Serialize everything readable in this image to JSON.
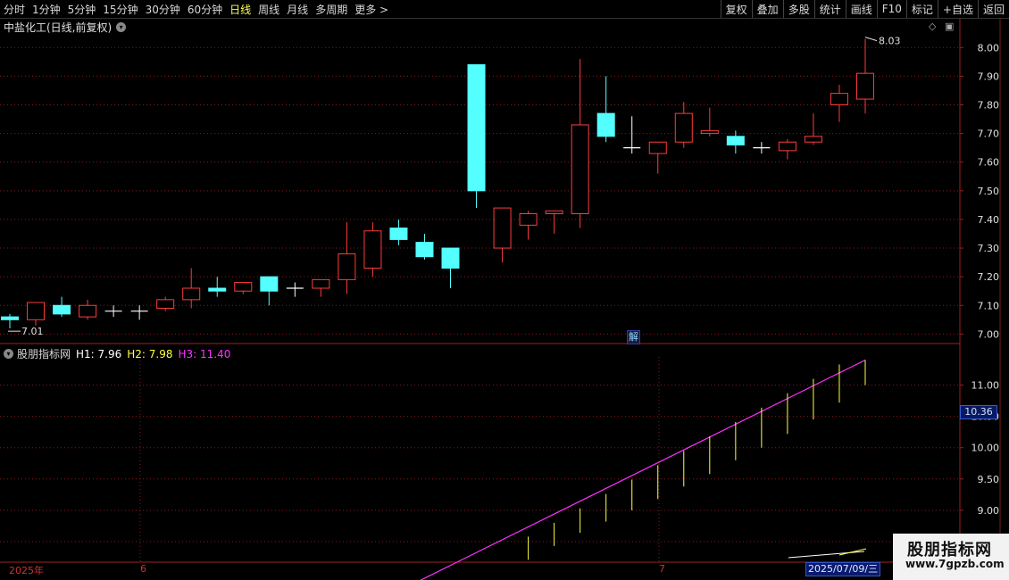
{
  "toolbar": {
    "periods": [
      "分时",
      "1分钟",
      "5分钟",
      "15分钟",
      "30分钟",
      "60分钟",
      "日线",
      "周线",
      "月线",
      "多周期",
      "更多 >"
    ],
    "active": "日线",
    "right_buttons": [
      "复权",
      "叠加",
      "多股",
      "统计",
      "画线",
      "F10",
      "标记",
      "+自选",
      "返回"
    ]
  },
  "main_chart": {
    "title": "中盐化工(日线,前复权)",
    "high_label": "8.03",
    "low_label": "7.01",
    "jie_label": "解"
  },
  "indicator": {
    "name": "股朋指标网",
    "h1": "H1: 7.96",
    "h2": "H2: 7.98",
    "h3": "H3: 11.40",
    "current_value": "10.36"
  },
  "dates": {
    "year": "2025年",
    "month6": "6",
    "month7": "7",
    "selected": "2025/07/09/三"
  },
  "watermark": {
    "line1": "股朋指标网",
    "line2": "www.7gpzb.com"
  },
  "colors": {
    "up": "#ff3c3c",
    "down": "#54ffff",
    "h3": "#ff33ff",
    "h1": "#ffffff",
    "h2": "#ffff44",
    "grid": "#8a1a1a"
  },
  "chart_data": {
    "type": "candlestick",
    "y_ticks": [
      "8.00",
      "7.90",
      "7.80",
      "7.70",
      "7.60",
      "7.50",
      "7.40",
      "7.30",
      "7.20",
      "7.10",
      "7.00"
    ],
    "y_range": [
      6.97,
      8.06
    ],
    "candles": [
      {
        "o": 7.06,
        "h": 7.07,
        "l": 7.02,
        "c": 7.05
      },
      {
        "o": 7.05,
        "h": 7.11,
        "l": 7.03,
        "c": 7.11
      },
      {
        "o": 7.1,
        "h": 7.13,
        "l": 7.06,
        "c": 7.07
      },
      {
        "o": 7.06,
        "h": 7.12,
        "l": 7.05,
        "c": 7.1
      },
      {
        "o": 7.08,
        "h": 7.1,
        "l": 7.06,
        "c": 7.08
      },
      {
        "o": 7.08,
        "h": 7.1,
        "l": 7.05,
        "c": 7.08
      },
      {
        "o": 7.09,
        "h": 7.13,
        "l": 7.08,
        "c": 7.12
      },
      {
        "o": 7.12,
        "h": 7.23,
        "l": 7.09,
        "c": 7.16
      },
      {
        "o": 7.16,
        "h": 7.2,
        "l": 7.13,
        "c": 7.15
      },
      {
        "o": 7.15,
        "h": 7.18,
        "l": 7.14,
        "c": 7.18
      },
      {
        "o": 7.2,
        "h": 7.2,
        "l": 7.1,
        "c": 7.15
      },
      {
        "o": 7.16,
        "h": 7.18,
        "l": 7.13,
        "c": 7.16
      },
      {
        "o": 7.16,
        "h": 7.19,
        "l": 7.13,
        "c": 7.19
      },
      {
        "o": 7.19,
        "h": 7.39,
        "l": 7.14,
        "c": 7.28
      },
      {
        "o": 7.23,
        "h": 7.39,
        "l": 7.2,
        "c": 7.36
      },
      {
        "o": 7.37,
        "h": 7.4,
        "l": 7.31,
        "c": 7.33
      },
      {
        "o": 7.32,
        "h": 7.35,
        "l": 7.26,
        "c": 7.27
      },
      {
        "o": 7.3,
        "h": 7.3,
        "l": 7.16,
        "c": 7.23
      },
      {
        "o": 7.94,
        "h": 7.94,
        "l": 7.44,
        "c": 7.5
      },
      {
        "o": 7.3,
        "h": 7.44,
        "l": 7.25,
        "c": 7.44
      },
      {
        "o": 7.38,
        "h": 7.43,
        "l": 7.33,
        "c": 7.42
      },
      {
        "o": 7.42,
        "h": 7.43,
        "l": 7.35,
        "c": 7.43
      },
      {
        "o": 7.42,
        "h": 7.96,
        "l": 7.37,
        "c": 7.73
      },
      {
        "o": 7.77,
        "h": 7.9,
        "l": 7.67,
        "c": 7.69
      },
      {
        "o": 7.65,
        "h": 7.76,
        "l": 7.63,
        "c": 7.65
      },
      {
        "o": 7.63,
        "h": 7.67,
        "l": 7.56,
        "c": 7.67
      },
      {
        "o": 7.67,
        "h": 7.81,
        "l": 7.65,
        "c": 7.77
      },
      {
        "o": 7.7,
        "h": 7.79,
        "l": 7.69,
        "c": 7.71
      },
      {
        "o": 7.69,
        "h": 7.71,
        "l": 7.63,
        "c": 7.66
      },
      {
        "o": 7.65,
        "h": 7.67,
        "l": 7.63,
        "c": 7.65
      },
      {
        "o": 7.64,
        "h": 7.68,
        "l": 7.61,
        "c": 7.67
      },
      {
        "o": 7.67,
        "h": 7.77,
        "l": 7.66,
        "c": 7.69
      },
      {
        "o": 7.8,
        "h": 7.87,
        "l": 7.74,
        "c": 7.84
      },
      {
        "o": 7.82,
        "h": 8.03,
        "l": 7.77,
        "c": 7.91
      }
    ],
    "indicator_y_ticks": [
      "11.00",
      "10.50",
      "10.00",
      "9.50",
      "9.00",
      "8.50"
    ],
    "indicator_y_range": [
      8.2,
      11.45
    ],
    "h3_line": {
      "start": 7.7,
      "end": 11.4
    },
    "yellow_marks": [
      {
        "i": 19,
        "top": 8.58,
        "bottom": 8.21
      },
      {
        "i": 20,
        "top": 8.8,
        "bottom": 8.43
      },
      {
        "i": 21,
        "top": 9.03,
        "bottom": 8.64
      },
      {
        "i": 22,
        "top": 9.26,
        "bottom": 8.82
      },
      {
        "i": 23,
        "top": 9.49,
        "bottom": 9.0
      },
      {
        "i": 24,
        "top": 9.72,
        "bottom": 9.18
      },
      {
        "i": 25,
        "top": 9.95,
        "bottom": 9.38
      },
      {
        "i": 26,
        "top": 10.18,
        "bottom": 9.58
      },
      {
        "i": 27,
        "top": 10.41,
        "bottom": 9.8
      },
      {
        "i": 28,
        "top": 10.64,
        "bottom": 10.0
      },
      {
        "i": 29,
        "top": 10.87,
        "bottom": 10.22
      },
      {
        "i": 30,
        "top": 11.1,
        "bottom": 10.45
      },
      {
        "i": 31,
        "top": 11.33,
        "bottom": 10.72
      },
      {
        "i": 32,
        "top": 11.4,
        "bottom": 11.0
      }
    ]
  }
}
